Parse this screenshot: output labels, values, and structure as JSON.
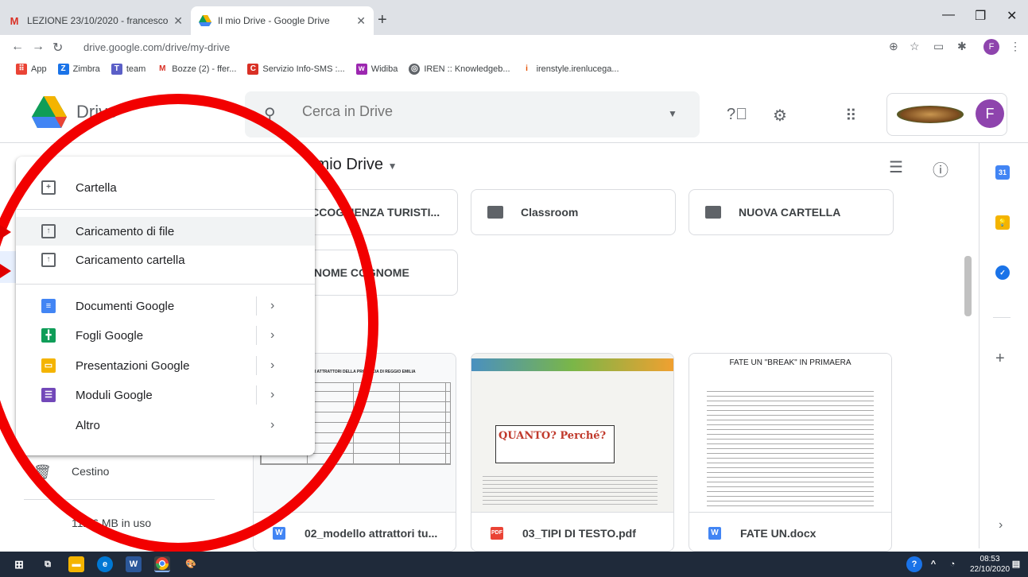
{
  "browser": {
    "tabs": [
      {
        "title": "LEZIONE 23/10/2020 - francesco",
        "favicon": "gmail-icon"
      },
      {
        "title": "Il mio Drive - Google Drive",
        "favicon": "drive-icon"
      }
    ],
    "url": "drive.google.com/drive/my-drive",
    "bookmarks": [
      {
        "label": "App",
        "icon": "apps-icon"
      },
      {
        "label": "Zimbra",
        "icon": "zimbra-icon"
      },
      {
        "label": "team",
        "icon": "teams-icon"
      },
      {
        "label": "Bozze (2) - ffer...",
        "icon": "gmail-icon"
      },
      {
        "label": "Servizio Info-SMS :...",
        "icon": "sms-icon"
      },
      {
        "label": "Widiba",
        "icon": "widiba-icon"
      },
      {
        "label": "IREN :: Knowledgeb...",
        "icon": "globe-icon"
      },
      {
        "label": "irenstyle.irenlucega...",
        "icon": "iren-icon"
      }
    ]
  },
  "drive": {
    "brand": "Drive",
    "search_placeholder": "Cerca in Drive",
    "avatar_letter": "F",
    "section_title": "Il mio Drive",
    "folders": [
      {
        "name": "ACCOGLIENZA TURISTI..."
      },
      {
        "name": "Classroom"
      },
      {
        "name": "NUOVA CARTELLA"
      },
      {
        "name": "C NOME COGNOME"
      }
    ],
    "files": [
      {
        "name": "02_modello attrattori tu...",
        "type": "W",
        "type_color": "#4285f4"
      },
      {
        "name": "03_TIPI DI TESTO.pdf",
        "type": "PDF",
        "type_color": "#ea4335"
      },
      {
        "name": "FATE UN.docx",
        "type": "W",
        "type_color": "#4285f4"
      }
    ],
    "thumbs": {
      "doc1_heading": "GLI ATTRATTORI DELLA PROVINCIA DI REGGIO EMILIA",
      "doc2_heading": "QUANTO? Perché?",
      "doc3_heading": "FATE UN \"BREAK\" IN PRIMAERA"
    },
    "sidebar": {
      "trash": "Cestino",
      "storage": "112,6 MB in uso"
    }
  },
  "new_menu": {
    "items": [
      {
        "label": "Cartella",
        "icon": "folder-plus-icon"
      },
      {
        "label": "Caricamento di file",
        "icon": "file-upload-icon"
      },
      {
        "label": "Caricamento cartella",
        "icon": "folder-upload-icon"
      },
      {
        "label": "Documenti Google",
        "icon": "google-docs-icon",
        "color": "#4285f4"
      },
      {
        "label": "Fogli Google",
        "icon": "google-sheets-icon",
        "color": "#0f9d58"
      },
      {
        "label": "Presentazioni Google",
        "icon": "google-slides-icon",
        "color": "#f4b400"
      },
      {
        "label": "Moduli Google",
        "icon": "google-forms-icon",
        "color": "#7248b9"
      },
      {
        "label": "Altro",
        "icon": ""
      }
    ]
  },
  "taskbar": {
    "time": "08:53",
    "date": "22/10/2020"
  },
  "colors": {
    "annotation": "#f20000",
    "accent": "#1a73e8"
  }
}
